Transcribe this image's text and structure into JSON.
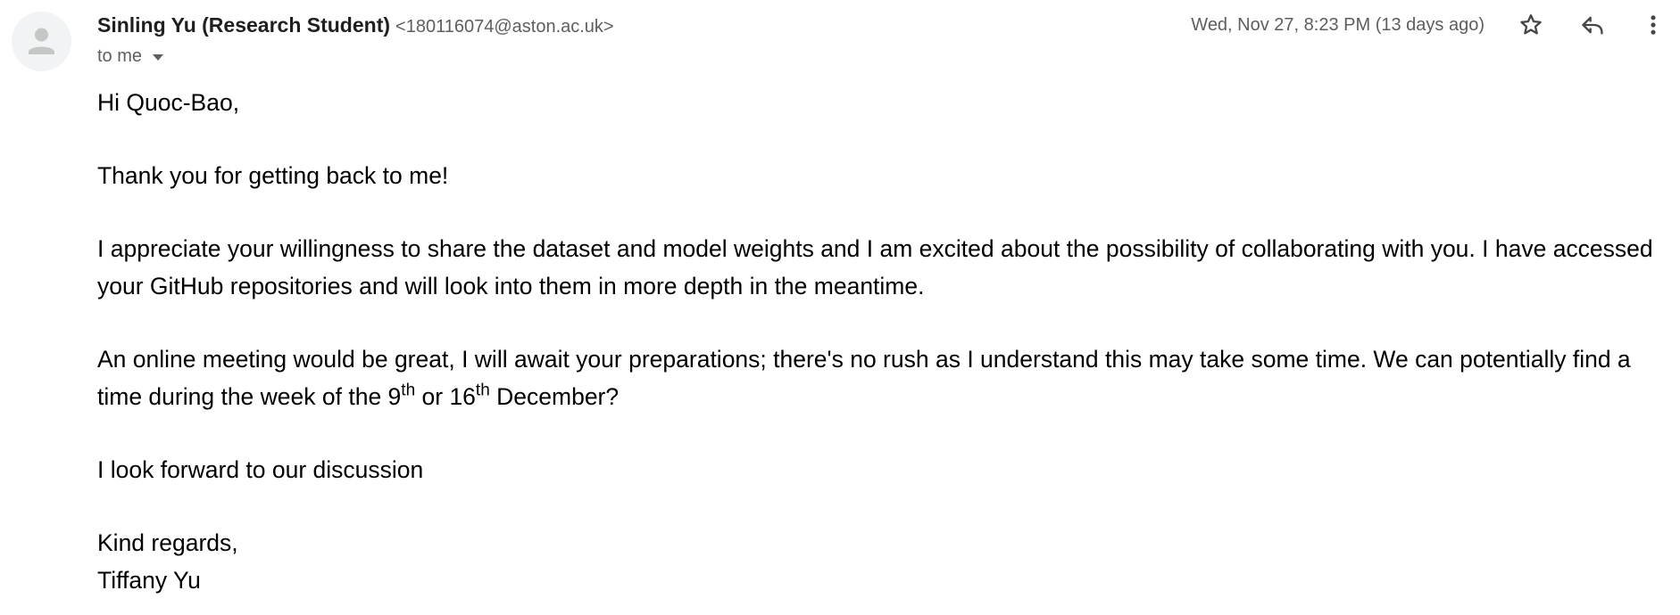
{
  "sender": {
    "name": "Sinling Yu (Research Student)",
    "email": "<180116074@aston.ac.uk>"
  },
  "recipient": {
    "label": "to me"
  },
  "timestamp": "Wed, Nov 27, 8:23 PM (13 days ago)",
  "icons": {
    "avatar": "person-avatar-icon",
    "caret": "caret-down-icon",
    "star": "star-outline-icon",
    "reply": "reply-icon",
    "more": "more-vert-icon"
  },
  "colors": {
    "secondary_text": "#5e5e5e",
    "body_text": "#000000",
    "avatar_bg": "#f1f3f4",
    "avatar_fg": "#c4c7c5"
  },
  "body": {
    "greeting": "Hi Quoc-Bao,",
    "thanks": "Thank you for getting back to me!",
    "paragraph1": "I appreciate your willingness to share the dataset and model weights and I am excited about the possibility of collaborating with you. I have accessed your GitHub repositories and will look into them in more depth in the meantime.",
    "paragraph2_part1": "An online meeting would be great, I will await your preparations; there's no rush as I understand this may take some time. We can potentially find a time during the week of the 9",
    "paragraph2_sup1": "th",
    "paragraph2_part2": " or 16",
    "paragraph2_sup2": "th",
    "paragraph2_part3": " December?",
    "closing_line": "I look forward to our discussion",
    "signoff": "Kind regards,",
    "signature": "Tiffany Yu"
  }
}
